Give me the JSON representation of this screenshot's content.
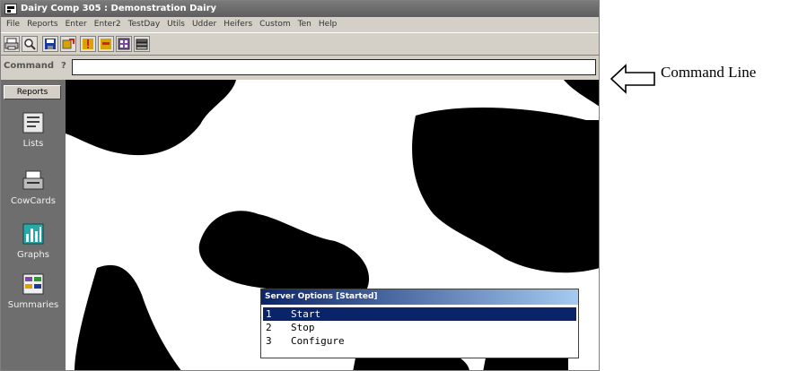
{
  "window": {
    "title": "Dairy Comp 305 : Demonstration Dairy"
  },
  "menu": [
    "File",
    "Reports",
    "Enter",
    "Enter2",
    "TestDay",
    "Utils",
    "Udder",
    "Heifers",
    "Custom",
    "Ten",
    "Help"
  ],
  "toolbar": {
    "buttons": [
      "print-icon",
      "zoom-icon",
      "save-icon",
      "export-icon",
      "flag-icon",
      "tag-icon",
      "calculator-icon",
      "stack-icon"
    ],
    "colors": {
      "accent": "#d9a400",
      "red": "#d02020",
      "blue": "#1a3a9a"
    }
  },
  "command": {
    "label": "Command",
    "prompt": "?",
    "value": ""
  },
  "sidebar": {
    "tab": "Reports",
    "items": [
      {
        "label": "Lists",
        "icon": "list-icon"
      },
      {
        "label": "CowCards",
        "icon": "cowcard-icon"
      },
      {
        "label": "Graphs",
        "icon": "graph-icon"
      },
      {
        "label": "Summaries",
        "icon": "summary-icon"
      }
    ]
  },
  "dialog": {
    "title": "Server Options [Started]",
    "options": [
      {
        "number": "1",
        "label": "Start"
      },
      {
        "number": "2",
        "label": "Stop"
      },
      {
        "number": "3",
        "label": "Configure"
      }
    ],
    "selected": "Start"
  },
  "annotation": {
    "label": "Command Line",
    "icon": "left-arrow-icon"
  },
  "colors": {
    "workspace_pattern": "#000000",
    "sidebar_bg": "#6e6e6e",
    "dialog_title": "#0a246a"
  }
}
